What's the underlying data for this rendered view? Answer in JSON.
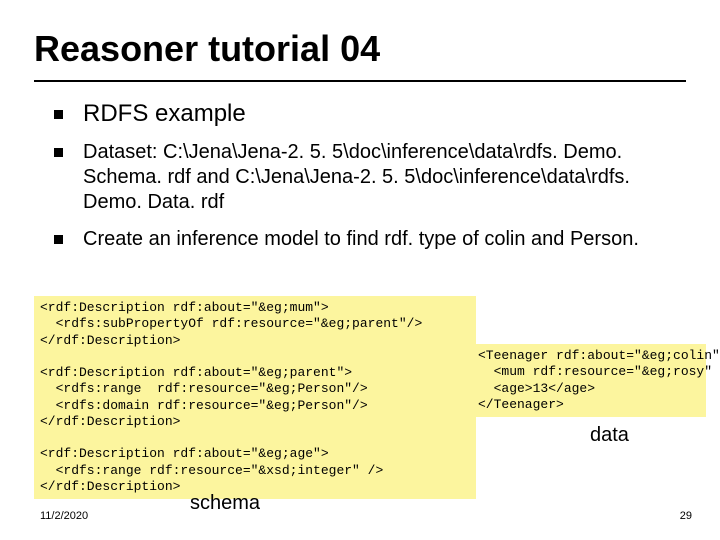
{
  "title": "Reasoner tutorial 04",
  "bullets": {
    "main": "RDFS example",
    "sub1": "Dataset: C:\\Jena\\Jena-2. 5. 5\\doc\\inference\\data\\rdfs. Demo. Schema. rdf and C:\\Jena\\Jena-2. 5. 5\\doc\\inference\\data\\rdfs. Demo. Data. rdf",
    "sub2": "Create an inference model to find rdf. type of colin and Person."
  },
  "code": {
    "left": "<rdf:Description rdf:about=\"&eg;mum\">\n  <rdfs:subPropertyOf rdf:resource=\"&eg;parent\"/>\n</rdf:Description>\n\n<rdf:Description rdf:about=\"&eg;parent\">\n  <rdfs:range  rdf:resource=\"&eg;Person\"/>\n  <rdfs:domain rdf:resource=\"&eg;Person\"/>\n</rdf:Description>\n\n<rdf:Description rdf:about=\"&eg;age\">\n  <rdfs:range rdf:resource=\"&xsd;integer\" />\n</rdf:Description>",
    "right": "<Teenager rdf:about=\"&eg;colin\">\n  <mum rdf:resource=\"&eg;rosy\" />\n  <age>13</age>\n</Teenager>"
  },
  "labels": {
    "schema": "schema",
    "data": "data"
  },
  "footer": {
    "date": "11/2/2020",
    "page": "29"
  }
}
